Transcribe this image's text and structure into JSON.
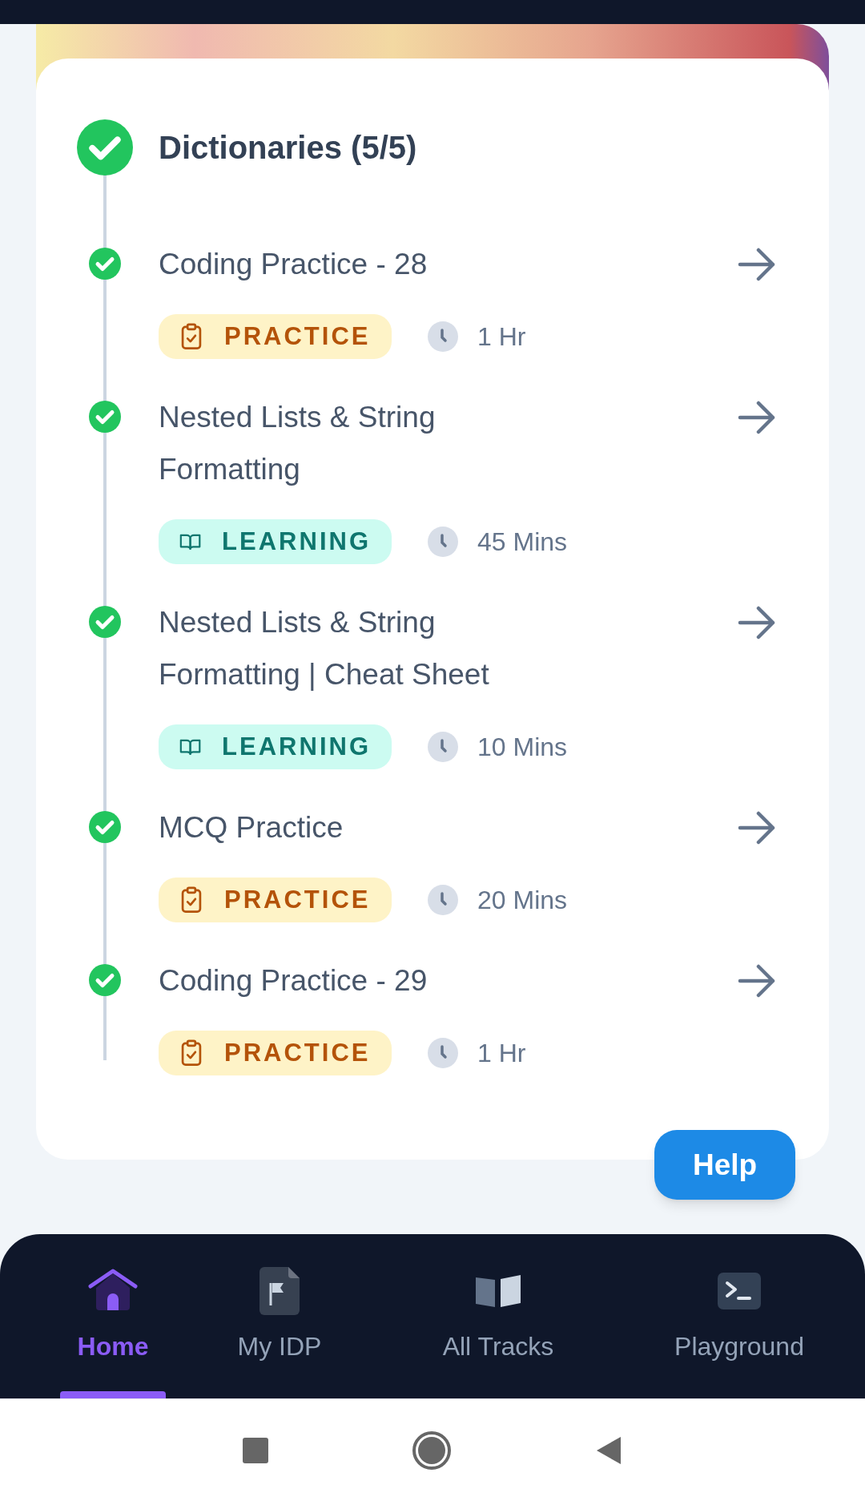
{
  "section": {
    "title": "Dictionaries (5/5)",
    "completed": true
  },
  "items": [
    {
      "title": "Coding Practice - 28",
      "kind": "practice",
      "tag": "PRACTICE",
      "duration": "1 Hr",
      "completed": true
    },
    {
      "title": "Nested Lists & String Formatting",
      "kind": "learning",
      "tag": "LEARNING",
      "duration": "45 Mins",
      "completed": true
    },
    {
      "title": "Nested Lists & String Formatting | Cheat Sheet",
      "kind": "learning",
      "tag": "LEARNING",
      "duration": "10 Mins",
      "completed": true
    },
    {
      "title": "MCQ Practice",
      "kind": "practice",
      "tag": "PRACTICE",
      "duration": "20 Mins",
      "completed": true
    },
    {
      "title": "Coding Practice - 29",
      "kind": "practice",
      "tag": "PRACTICE",
      "duration": "1 Hr",
      "completed": true
    }
  ],
  "help_button": "Help",
  "nav": [
    {
      "label": "Home",
      "kind": "home",
      "selected": true
    },
    {
      "label": "My IDP",
      "kind": "idp",
      "selected": false
    },
    {
      "label": "All Tracks",
      "kind": "tracks",
      "selected": false
    },
    {
      "label": "Playground",
      "kind": "playground",
      "selected": false
    }
  ]
}
